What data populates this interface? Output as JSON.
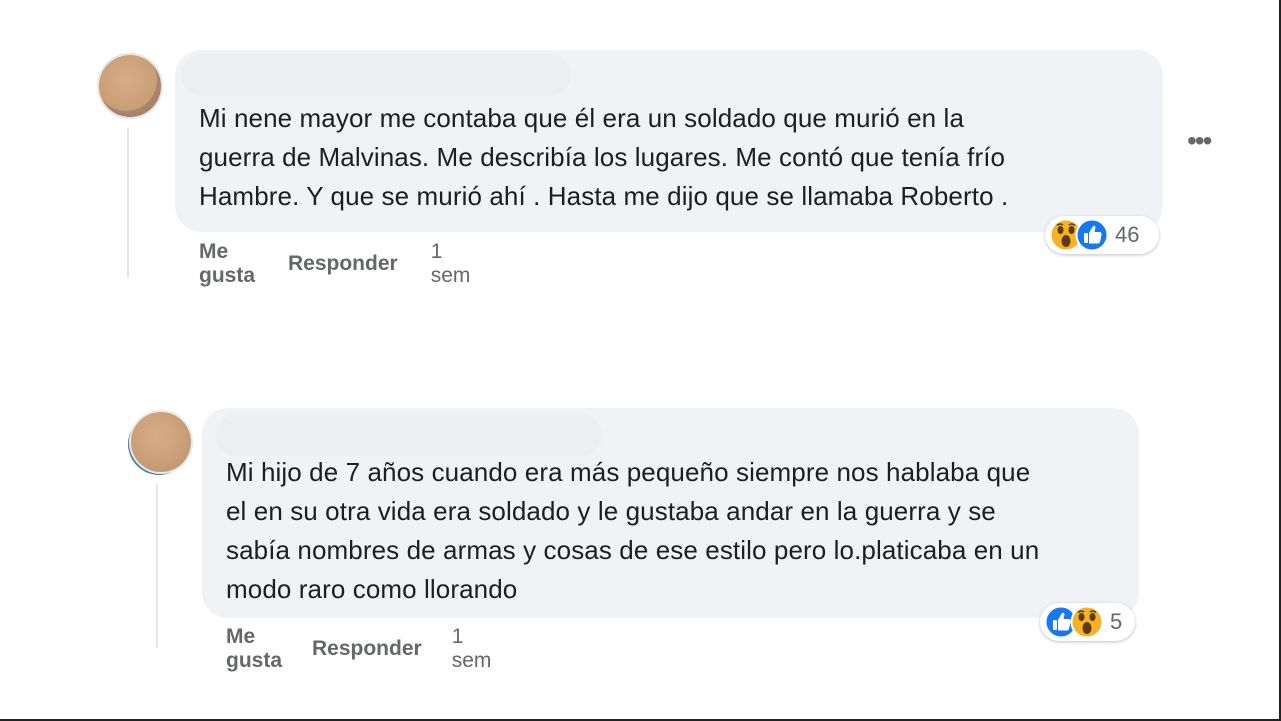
{
  "comments": [
    {
      "text_lines": [
        "Mi nene mayor me contaba que él era un soldado que murió en la",
        "guerra de Malvinas. Me describía los lugares. Me contó que tenía frío",
        "Hambre. Y que se murió ahí . Hasta me dijo que se llamaba Roberto ."
      ],
      "actions": {
        "like": "Me gusta",
        "reply": "Responder",
        "time": "1 sem"
      },
      "reactions": {
        "icons": [
          "wow-icon",
          "like-icon"
        ],
        "count": "46"
      },
      "more": "•••"
    },
    {
      "text_lines": [
        "Mi hijo de 7 años cuando era más pequeño siempre nos hablaba que",
        "el en su otra vida era soldado y le gustaba andar en la guerra y se",
        "sabía nombres de armas y cosas de ese estilo pero lo.platicaba en un",
        "modo raro como llorando"
      ],
      "actions": {
        "like": "Me gusta",
        "reply": "Responder",
        "time": "1 sem"
      },
      "reactions": {
        "icons": [
          "like-icon",
          "wow-icon"
        ],
        "count": "5"
      }
    }
  ],
  "colors": {
    "bubble": "#f0f2f5",
    "like_blue": "#1877f2",
    "wow_yellow": "#f7b125",
    "meta_text": "#65676b"
  }
}
